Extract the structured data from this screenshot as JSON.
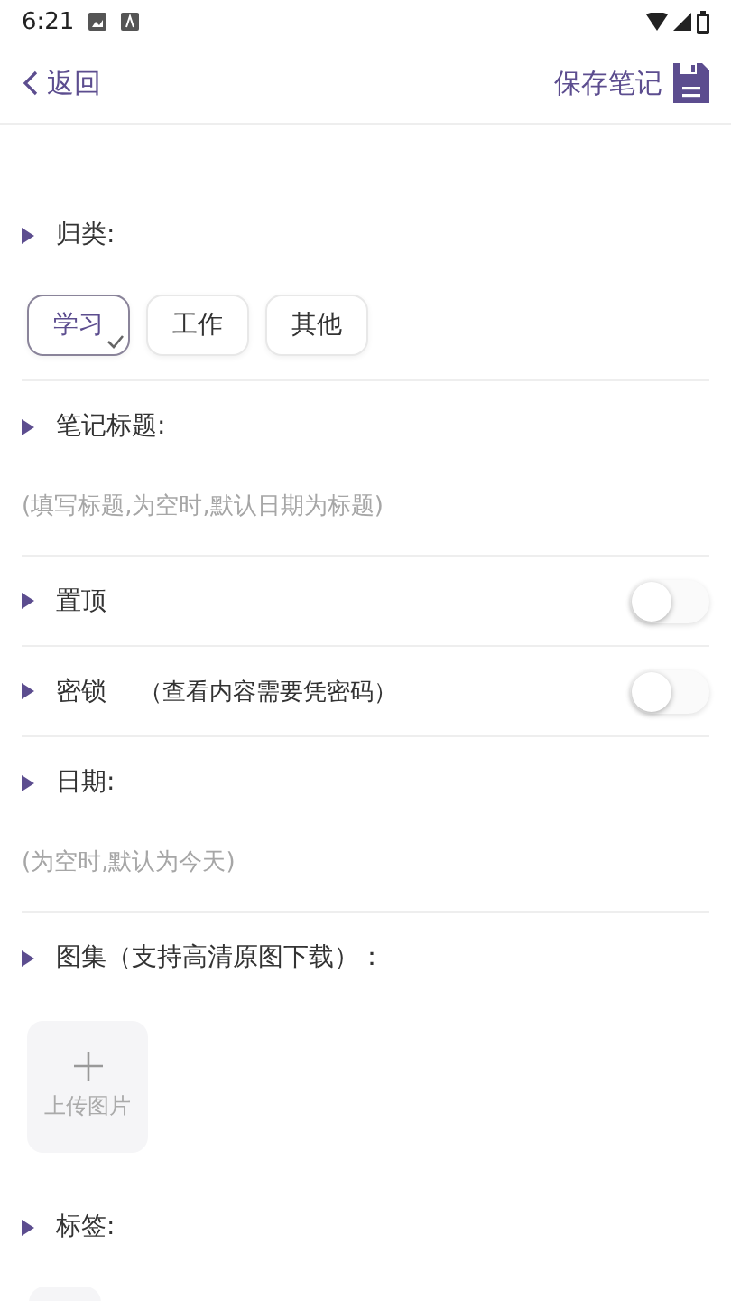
{
  "status_bar": {
    "time": "6:21"
  },
  "header": {
    "back": "返回",
    "save": "保存笔记"
  },
  "category": {
    "label": "归类:",
    "options": [
      {
        "label": "学习",
        "selected": true
      },
      {
        "label": "工作",
        "selected": false
      },
      {
        "label": "其他",
        "selected": false
      }
    ]
  },
  "title_field": {
    "label": "笔记标题:",
    "placeholder": "(填写标题,为空时,默认日期为标题)"
  },
  "toggles": [
    {
      "label": "置顶",
      "on": false
    },
    {
      "label": "密锁",
      "note": "（查看内容需要凭密码）",
      "on": false
    }
  ],
  "date_field": {
    "label": "日期:",
    "placeholder": "(为空时,默认为今天)"
  },
  "gallery": {
    "label": "图集（支持高清原图下载）：",
    "upload": "上传图片"
  },
  "tags": {
    "label": "标签:"
  }
}
